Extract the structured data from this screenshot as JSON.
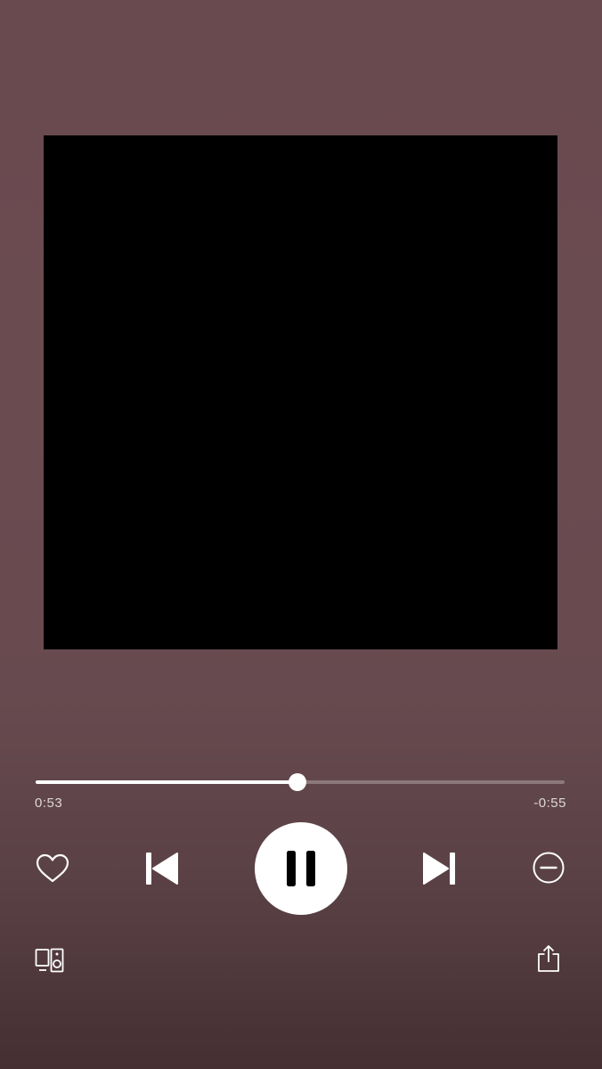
{
  "player": {
    "artwork_color": "#000000",
    "elapsed": "0:53",
    "remaining": "-0:55",
    "progress_fraction": 0.495
  },
  "controls": {
    "like": "heart-icon",
    "previous": "skip-previous-icon",
    "play_pause": "pause-icon",
    "next": "skip-next-icon",
    "hide": "minus-circle-icon"
  },
  "footer": {
    "devices": "connect-devices-icon",
    "share": "share-icon"
  },
  "colors": {
    "background": "#694a4f",
    "background_bottom": "#452f33",
    "accent": "#ffffff"
  }
}
